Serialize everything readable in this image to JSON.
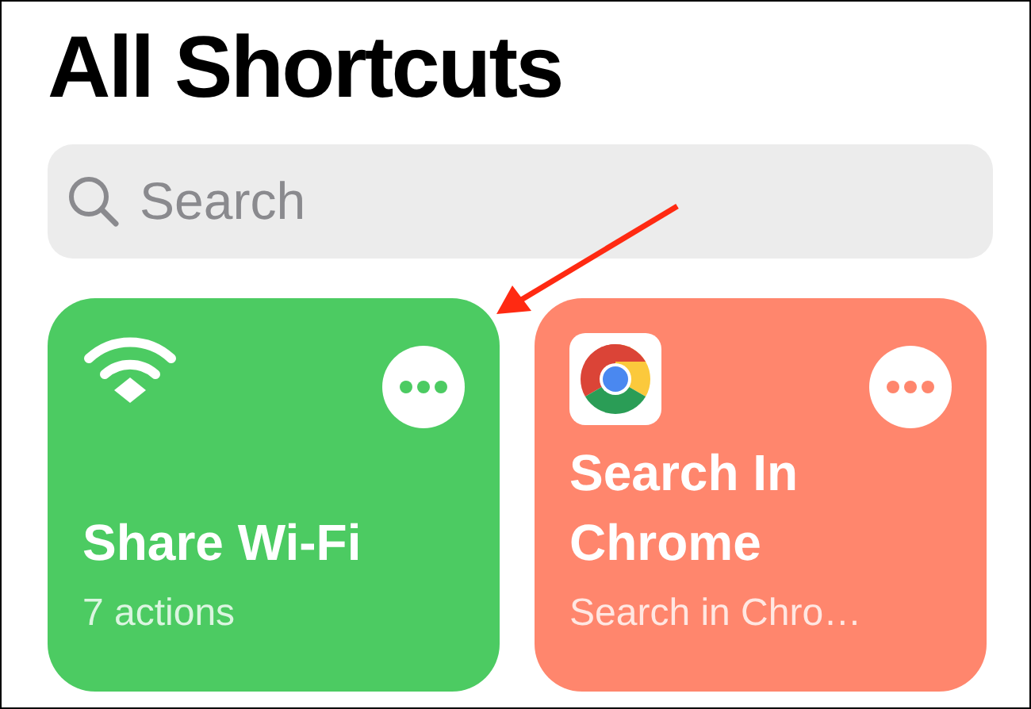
{
  "title": "All Shortcuts",
  "search": {
    "placeholder": "Search"
  },
  "shortcuts": [
    {
      "kind": "wifi",
      "color": "#4ccb62",
      "title": "Share Wi-Fi",
      "subtitle": "7 actions"
    },
    {
      "kind": "chrome",
      "color": "#ff866d",
      "title": "Search In Chrome",
      "subtitle": "Search in Chro…"
    }
  ]
}
